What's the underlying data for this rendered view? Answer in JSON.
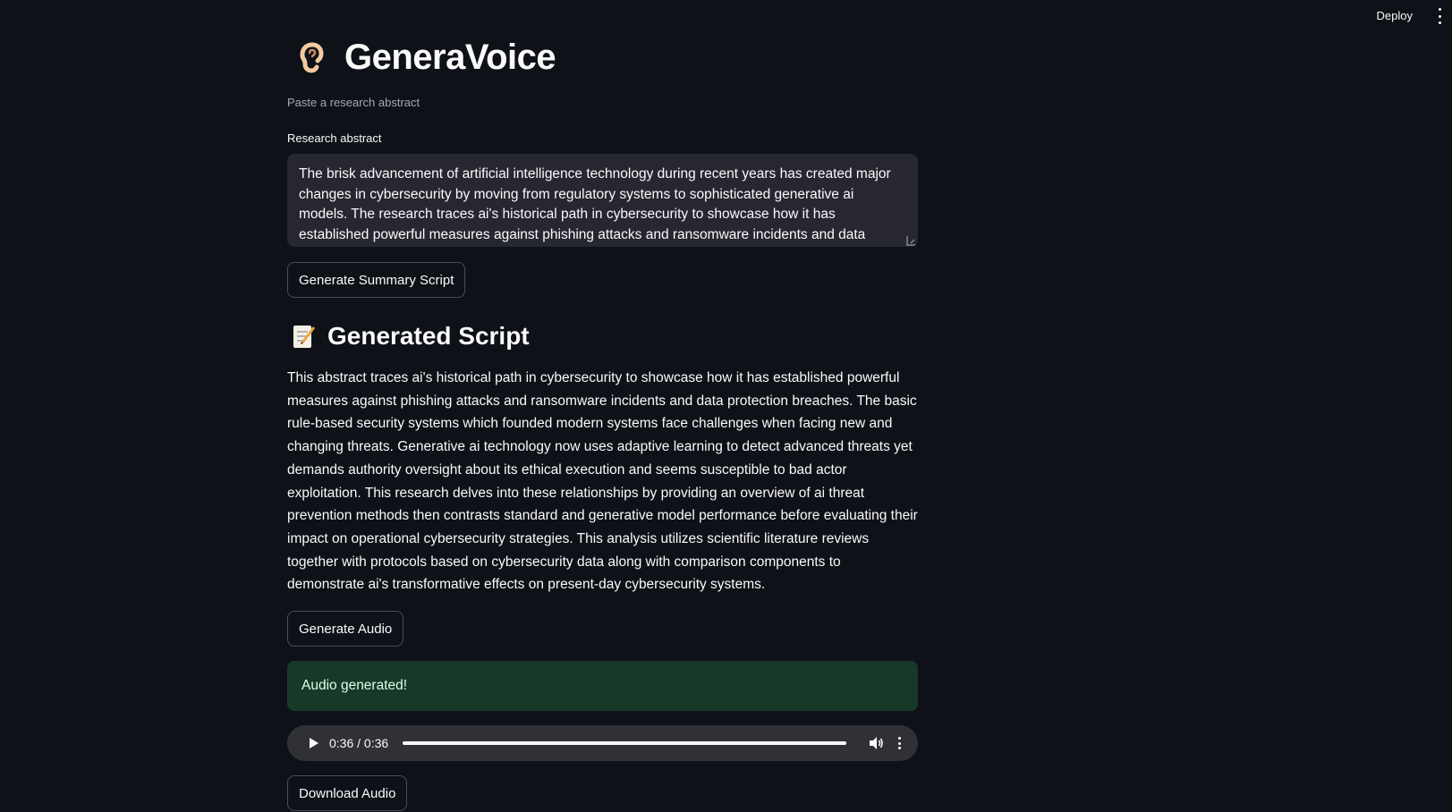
{
  "header": {
    "deploy_label": "Deploy",
    "menu_icon": "kebab-menu-icon"
  },
  "app": {
    "title_icon": "ear-icon",
    "title": "GeneraVoice",
    "subtitle": "Paste a research abstract"
  },
  "abstract_input": {
    "label": "Research abstract",
    "value": "The brisk advancement of artificial intelligence technology during recent years has created major changes in cybersecurity by moving from regulatory systems to sophisticated generative ai models. The research traces ai's historical path in cybersecurity to showcase how it has established powerful measures against phishing attacks and ransomware incidents and data protection breaches. The"
  },
  "buttons": {
    "generate_script": "Generate Summary Script",
    "generate_audio": "Generate Audio",
    "download_audio": "Download Audio"
  },
  "script_section": {
    "icon": "memo-icon",
    "title": "Generated Script",
    "text": "This abstract traces ai's historical path in cybersecurity to showcase how it has established powerful measures against phishing attacks and ransomware incidents and data protection breaches. The basic rule-based security systems which founded modern systems face challenges when facing new and changing threats. Generative ai technology now uses adaptive learning to detect advanced threats yet demands authority oversight about its ethical execution and seems susceptible to bad actor exploitation. This research delves into these relationships by providing an overview of ai threat prevention methods then contrasts standard and generative model performance before evaluating their impact on operational cybersecurity strategies. This analysis utilizes scientific literature reviews together with protocols based on cybersecurity data along with comparison components to demonstrate ai's transformative effects on present-day cybersecurity systems."
  },
  "status": {
    "message": "Audio generated!",
    "background": "#173928"
  },
  "audio_player": {
    "time": "0:36 / 0:36",
    "progress": 1.0
  },
  "colors": {
    "background": "#0e1117",
    "input_background": "#262730",
    "text": "#fafafa"
  }
}
